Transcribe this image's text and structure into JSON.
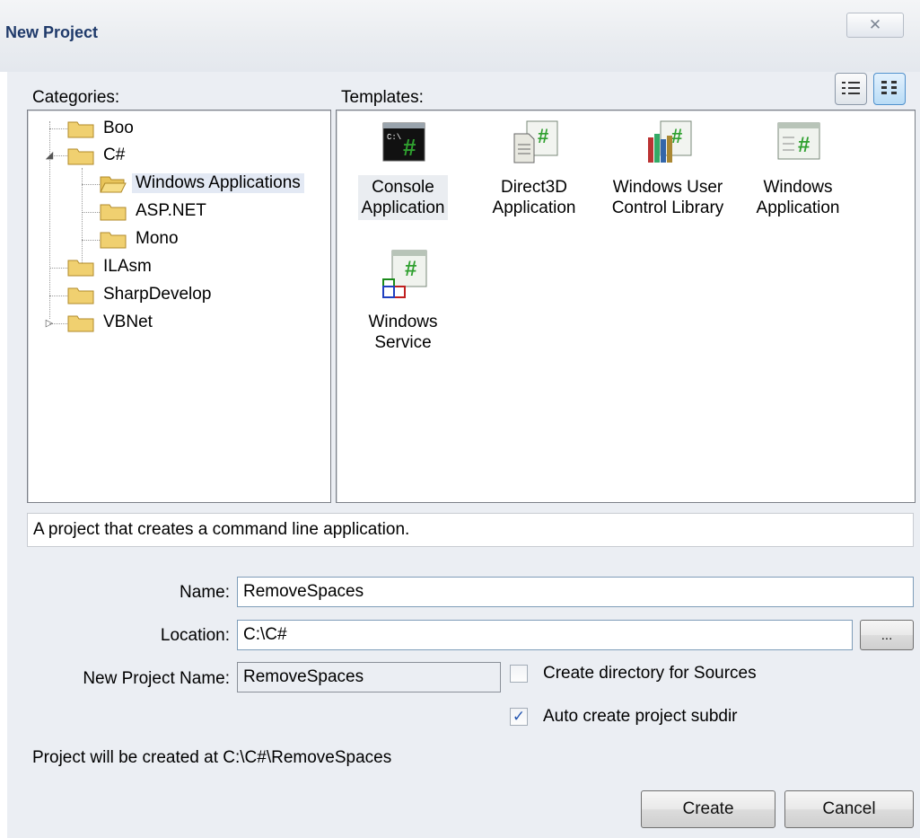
{
  "window": {
    "title": "New Project",
    "close_glyph": "✕"
  },
  "categories": {
    "label": "Categories:",
    "items": [
      {
        "label": "Boo"
      },
      {
        "label": "C#",
        "expander": "◢"
      },
      {
        "label": "Windows Applications",
        "selected": true
      },
      {
        "label": "ASP.NET"
      },
      {
        "label": "Mono"
      },
      {
        "label": "ILAsm"
      },
      {
        "label": "SharpDevelop"
      },
      {
        "label": "VBNet",
        "expander": "▷"
      }
    ]
  },
  "templates": {
    "label": "Templates:",
    "console_icon_text": "C:\\",
    "items": [
      {
        "line1": "Console",
        "line2": "Application",
        "icon": "console-app-icon",
        "selected": true
      },
      {
        "line1": "Direct3D",
        "line2": "Application",
        "icon": "direct3d-app-icon"
      },
      {
        "line1": "Windows User",
        "line2": "Control Library",
        "icon": "control-library-icon"
      },
      {
        "line1": "Windows",
        "line2": "Application",
        "icon": "windows-app-icon"
      },
      {
        "line1": "Windows",
        "line2": "Service",
        "icon": "windows-service-icon"
      }
    ],
    "view_buttons": [
      {
        "icon": "list-view-icon",
        "active": false
      },
      {
        "icon": "large-icons-view-icon",
        "active": true
      }
    ]
  },
  "description": "A project that creates a command line application.",
  "form": {
    "name_label": "Name:",
    "name_value": "RemoveSpaces",
    "location_label": "Location:",
    "location_value": "C:\\C#",
    "browse_label": "...",
    "new_project_name_label": "New Project Name:",
    "new_project_name_value": "RemoveSpaces",
    "create_dir_label": "Create directory for Sources",
    "create_dir_checked": false,
    "auto_subdir_label": "Auto create project subdir",
    "auto_subdir_checked": true,
    "check_glyph": "✓"
  },
  "path_info": "Project will be created at C:\\C#\\RemoveSpaces",
  "buttons": {
    "create": "Create",
    "cancel": "Cancel"
  },
  "colors": {
    "title_text": "#1f3a6a",
    "folder": "#f0d070",
    "hash_green": "#2fa02f",
    "selection": "#e3e9f4"
  }
}
